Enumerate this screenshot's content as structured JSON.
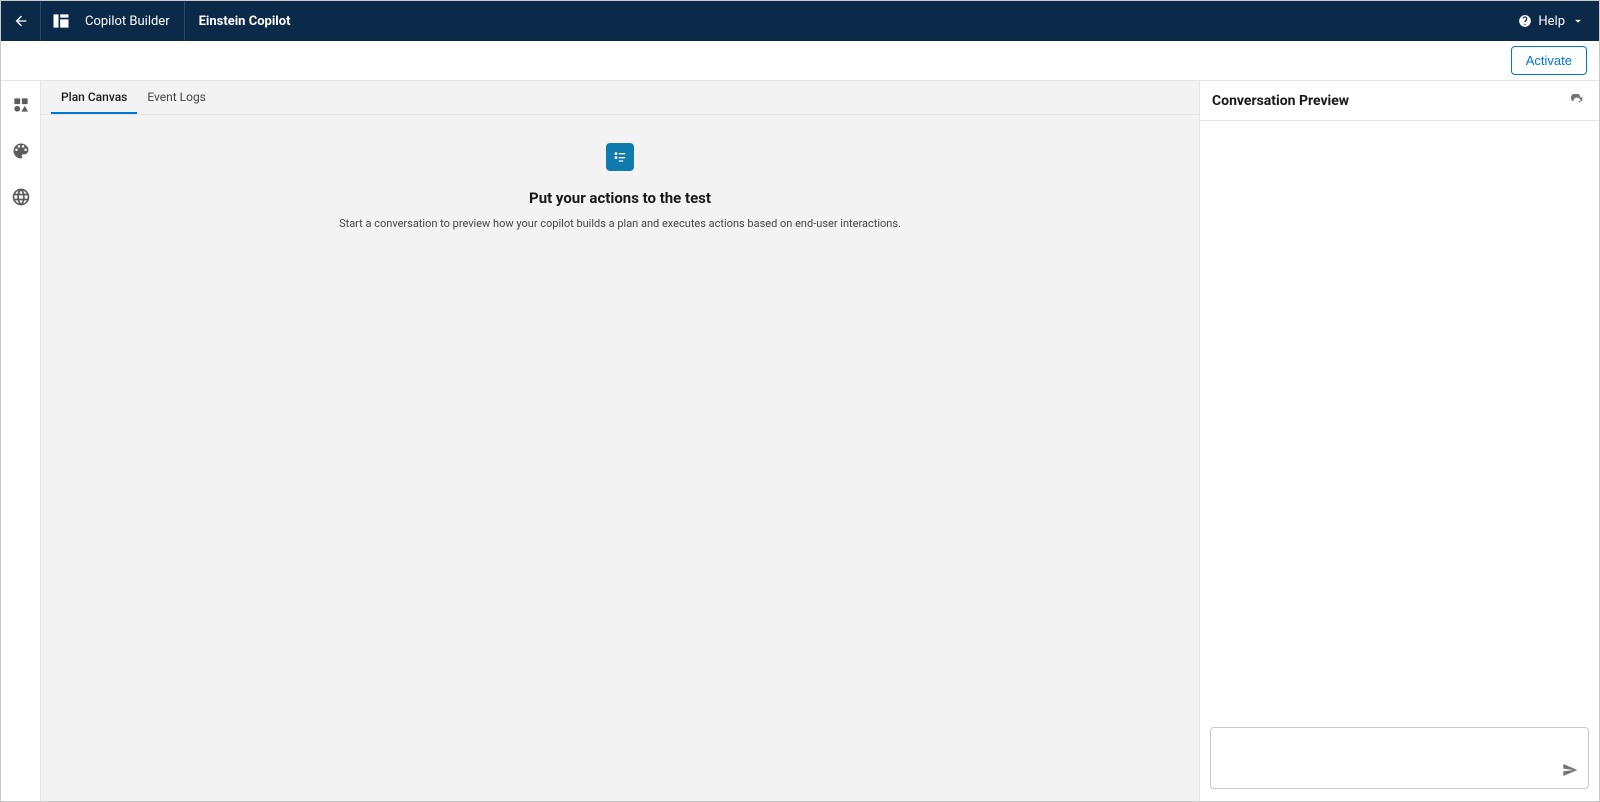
{
  "topbar": {
    "app_name": "Copilot Builder",
    "page_name": "Einstein Copilot",
    "help_label": "Help"
  },
  "subheader": {
    "activate_label": "Activate"
  },
  "tabs": [
    {
      "label": "Plan Canvas",
      "active": true
    },
    {
      "label": "Event Logs",
      "active": false
    }
  ],
  "empty_state": {
    "title": "Put your actions to the test",
    "description": "Start a conversation to preview how your copilot builds a plan and executes actions based on end-user interactions."
  },
  "conversation": {
    "title": "Conversation Preview",
    "input_placeholder": ""
  }
}
